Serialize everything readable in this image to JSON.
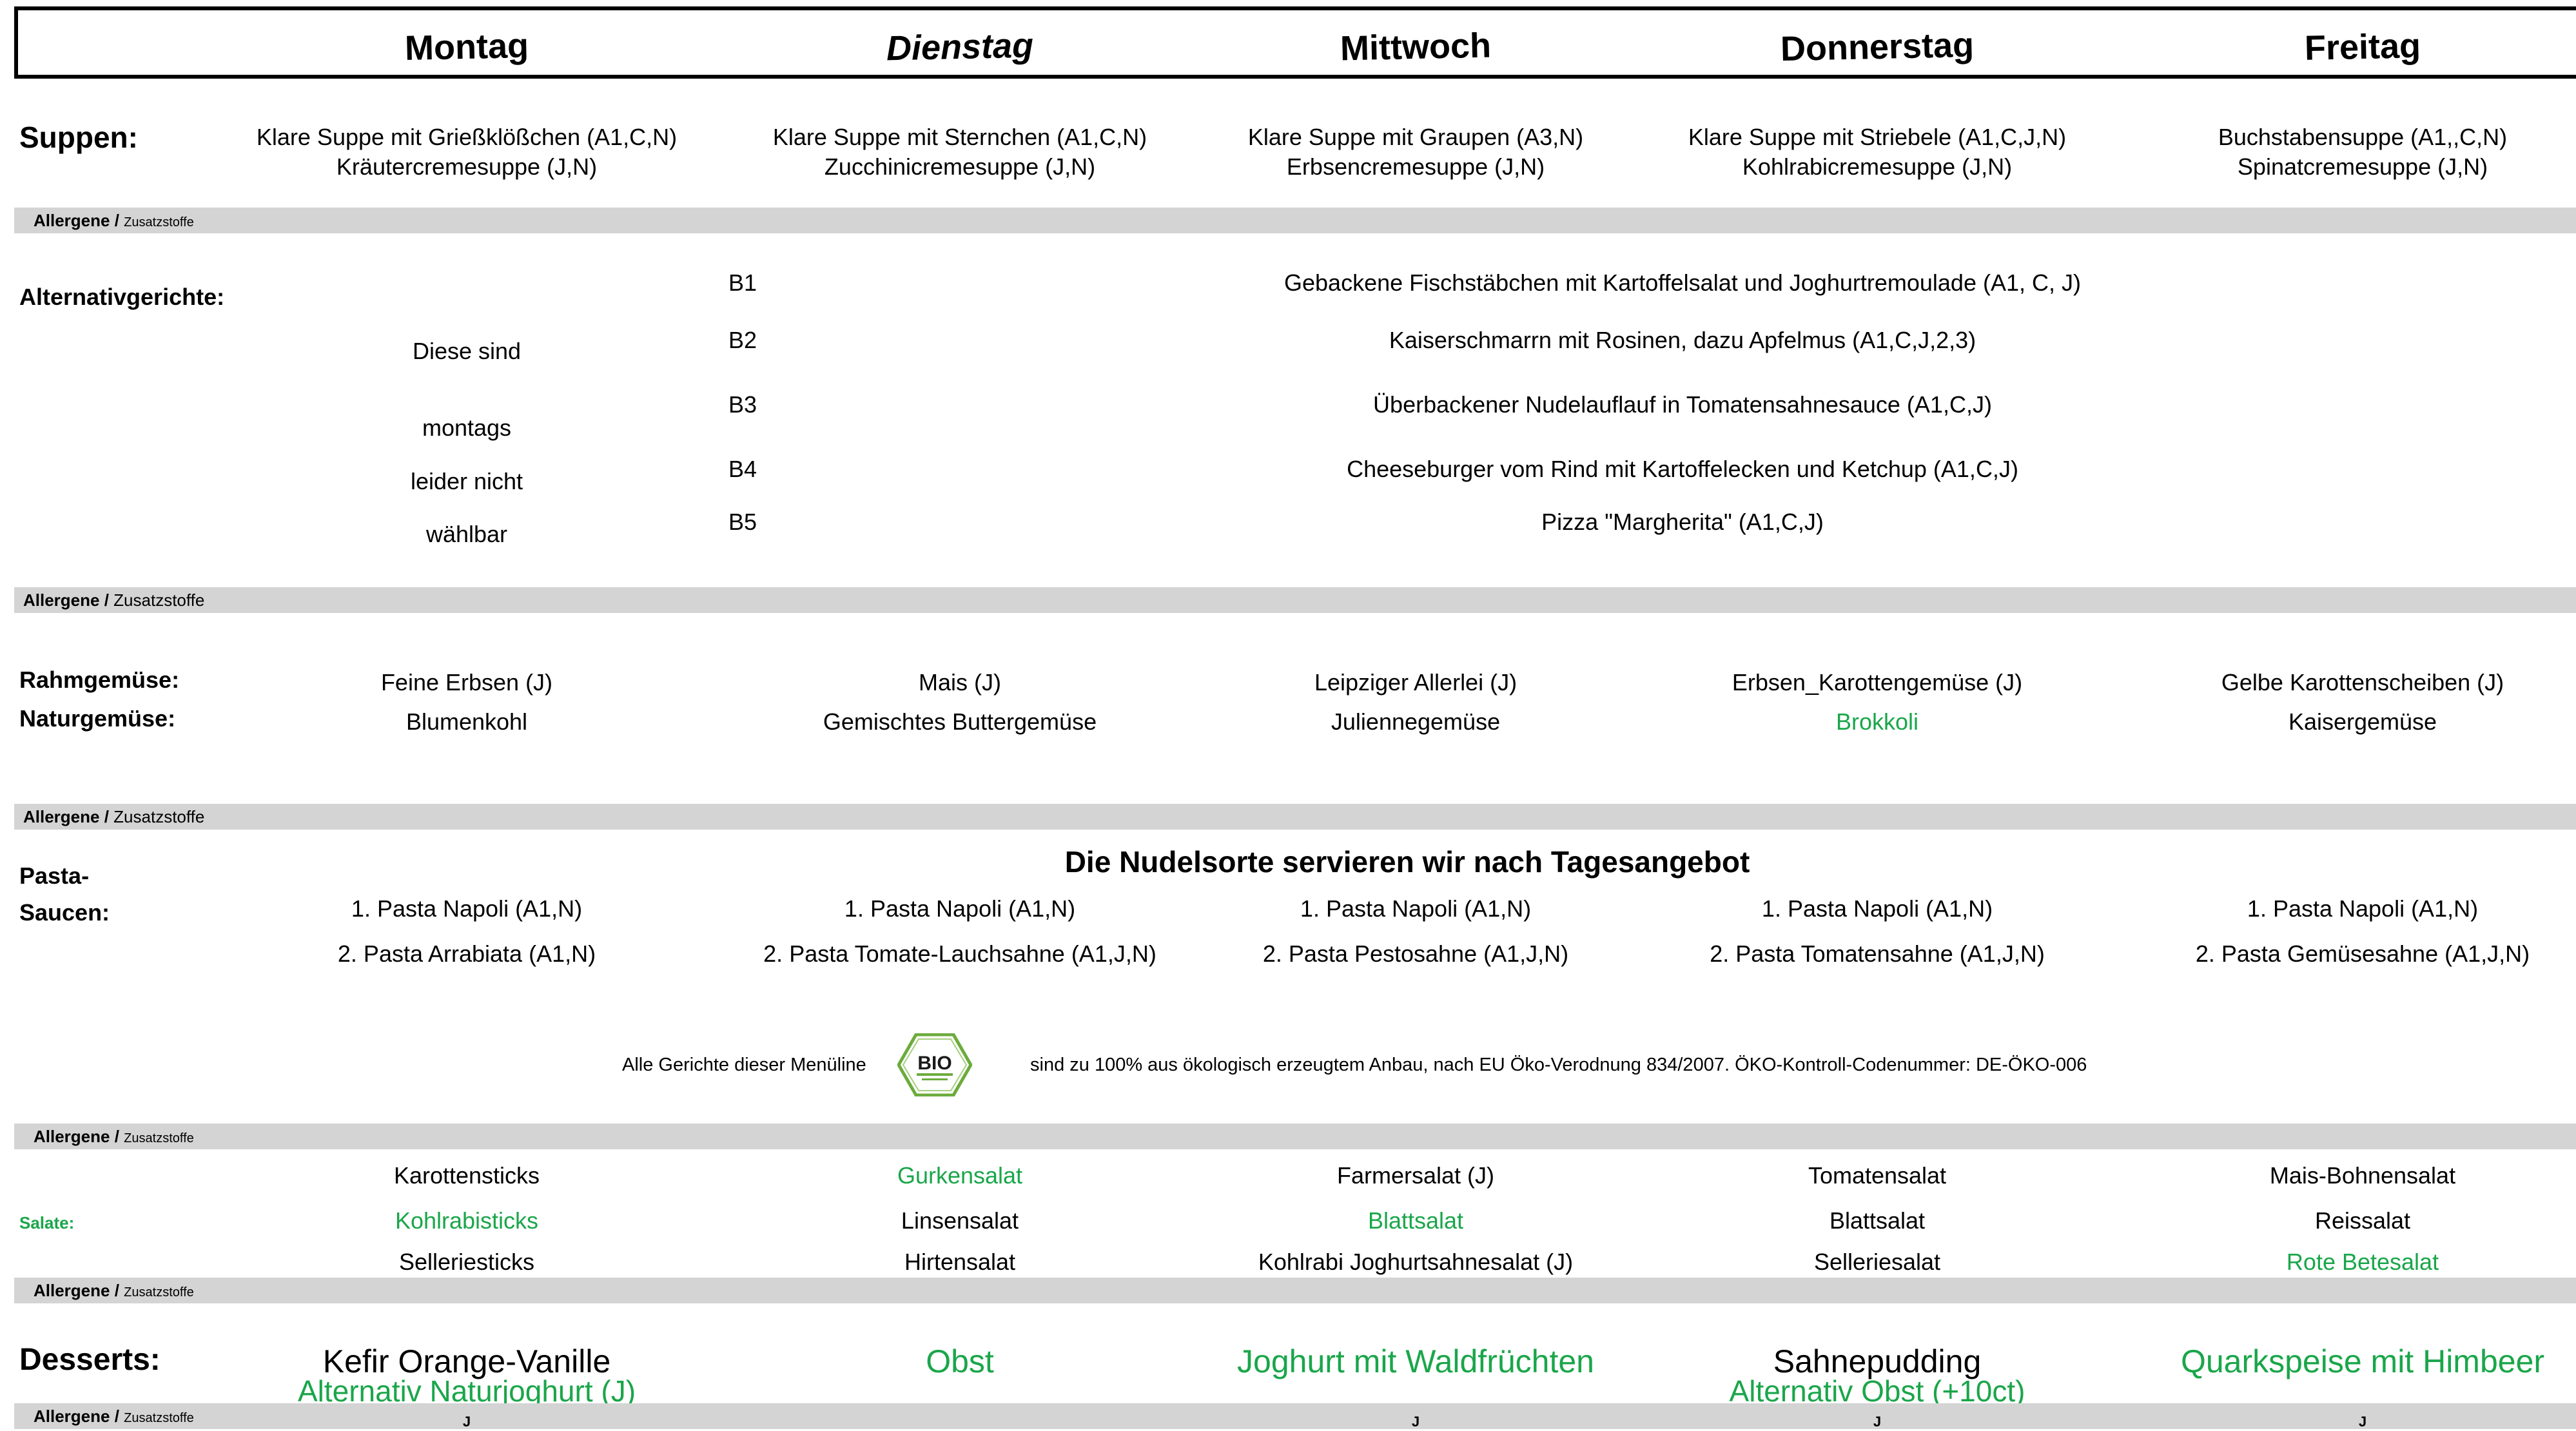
{
  "header": {
    "days": [
      "Montag",
      "Dienstag",
      "Mittwoch",
      "Donnerstag",
      "Freitag"
    ]
  },
  "soups": {
    "label": "Suppen:",
    "items": [
      [
        "Klare Suppe mit Grießklößchen (A1,C,N)",
        "Kräutercremesuppe (J,N)"
      ],
      [
        "Klare Suppe mit Sternchen (A1,C,N)",
        "Zucchinicremesuppe (J,N)"
      ],
      [
        "Klare Suppe mit Graupen (A3,N)",
        "Erbsencremesuppe (J,N)"
      ],
      [
        "Klare Suppe mit Striebele (A1,C,J,N)",
        "Kohlrabicremesuppe (J,N)"
      ],
      [
        "Buchstabensuppe (A1,,C,N)",
        "Spinatcremesuppe (J,N)"
      ]
    ]
  },
  "allergen_band": {
    "bold": "Allergene /",
    "small": "Zusatzstoffe"
  },
  "alternatives": {
    "label": "Alternativgerichte:",
    "monday_note": [
      "Diese sind",
      "montags",
      "leider nicht",
      "wählbar"
    ],
    "dishes": [
      {
        "code": "B1",
        "text": "Gebackene Fischstäbchen mit Kartoffelsalat und Joghurtremoulade (A1, C, J)"
      },
      {
        "code": "B2",
        "text": "Kaiserschmarrn mit Rosinen, dazu Apfelmus (A1,C,J,2,3)"
      },
      {
        "code": "B3",
        "text": "Überbackener Nudelauflauf in Tomatensahnesauce  (A1,C,J)"
      },
      {
        "code": "B4",
        "text": "Cheeseburger vom Rind mit Kartoffelecken und Ketchup (A1,C,J)"
      },
      {
        "code": "B5",
        "text": "Pizza \"Margherita\" (A1,C,J)"
      }
    ]
  },
  "vegetables": {
    "label_rahm": "Rahmgemüse:",
    "label_natur": "Naturgemüse:",
    "rahm": [
      "Feine Erbsen (J)",
      "Mais (J)",
      "Leipziger Allerlei (J)",
      "Erbsen_Karottengemüse (J)",
      "Gelbe Karottenscheiben (J)"
    ],
    "natur": [
      "Blumenkohl",
      "Gemischtes Buttergemüse",
      "Juliennegemüse",
      "Brokkoli",
      "Kaisergemüse"
    ]
  },
  "pasta": {
    "label_1": "Pasta-",
    "label_2": "Saucen:",
    "title": "Die Nudelsorte servieren wir nach Tagesangebot",
    "line1": [
      "1. Pasta Napoli (A1,N)",
      "1. Pasta Napoli (A1,N)",
      "1. Pasta Napoli (A1,N)",
      "1. Pasta Napoli (A1,N)",
      "1. Pasta Napoli (A1,N)"
    ],
    "line2": [
      "2. Pasta Arrabiata (A1,N)",
      "2. Pasta Tomate-Lauchsahne (A1,J,N)",
      "2. Pasta Pestosahne (A1,J,N)",
      "2. Pasta Tomatensahne (A1,J,N)",
      "2. Pasta Gemüsesahne (A1,J,N)"
    ]
  },
  "bio": {
    "left": "Alle Gerichte dieser Menüline",
    "logo_text": "BIO",
    "right": "sind zu 100% aus ökologisch erzeugtem Anbau, nach EU Öko-Verodnung 834/2007. ÖKO-Kontroll-Codenummer: DE-ÖKO-006"
  },
  "salads": {
    "label": "Salate:",
    "row1": [
      "Karottensticks",
      "Gurkensalat",
      "Farmersalat (J)",
      "Tomatensalat",
      "Mais-Bohnensalat"
    ],
    "row2": [
      "Kohlrabisticks",
      "Linsensalat",
      "Blattsalat",
      "Blattsalat",
      "Reissalat"
    ],
    "row3": [
      "Selleriesticks",
      "Hirtensalat",
      "Kohlrabi Joghurtsahnesalat (J)",
      "Selleriesalat",
      "Rote Betesalat"
    ]
  },
  "desserts": {
    "label": "Desserts:",
    "items": [
      "Kefir Orange-Vanille",
      "Obst",
      "Joghurt mit Waldfrüchten",
      "Sahnepudding",
      "Quarkspeise mit Himbeer"
    ],
    "alt": [
      "Alternativ Naturjoghurt (J)",
      "",
      "",
      "Alternativ Obst (+10ct)",
      ""
    ],
    "allergen_marks": [
      "J",
      "",
      "J",
      "J",
      "J"
    ]
  },
  "colors": {
    "green": "#1aa64a",
    "band": "#d4d4d4"
  }
}
